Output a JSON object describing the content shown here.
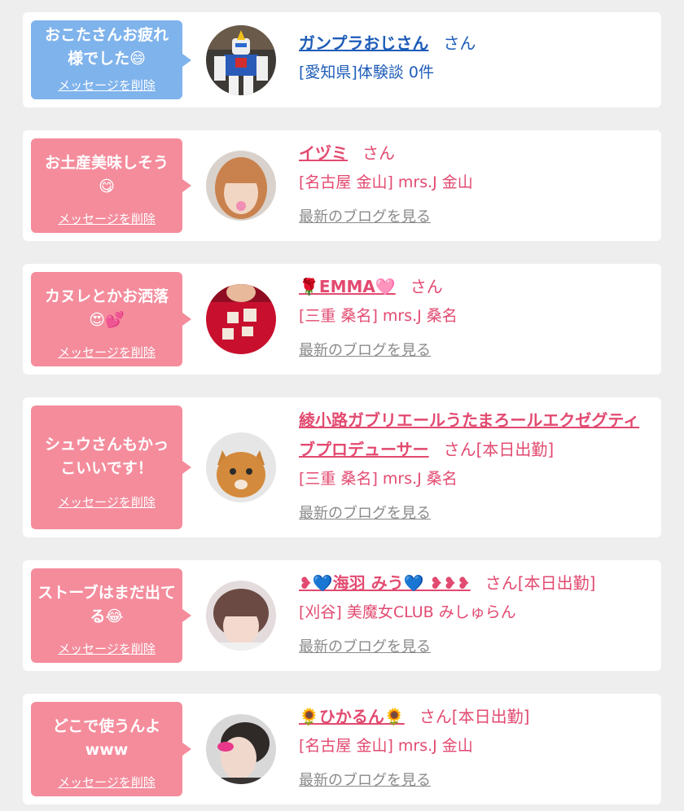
{
  "delete_label": "メッセージを削除",
  "blog_label": "最新のブログを見る",
  "colors": {
    "blue_bubble": "#7fb3ec",
    "pink_bubble": "#f48c9c",
    "blue_text": "#1d5cb8",
    "pink_text": "#e24a70",
    "gray_link": "#8a8a8a"
  },
  "entries": [
    {
      "message": "おこたさんお疲れ様でした😄",
      "name": "ガンプラおじさん",
      "honorific": "さん",
      "shop": "[愛知県]体験談 0件",
      "avatar_icon": "robot-figure-icon"
    },
    {
      "message": "お土産美味しそう😋",
      "name": "イヅミ",
      "honorific": "さん",
      "shop": "[名古屋 金山] mrs.J 金山",
      "avatar_icon": "woman-photo-icon"
    },
    {
      "message": "カヌレとかお洒落😍💕",
      "name": "🌹EMMA🩷",
      "honorific": "さん",
      "shop": "[三重 桑名] mrs.J 桑名",
      "avatar_icon": "red-shirt-photo-icon"
    },
    {
      "message": "シュウさんもかっこいいです！",
      "name": "綾小路ガブリエールうたまろールエクゼグティブプロデューサー",
      "honorific": "さん[本日出勤]",
      "shop": "[三重 桑名] mrs.J 桑名",
      "avatar_icon": "cat-photo-icon"
    },
    {
      "message": "ストーブはまだ出てる😂",
      "name": "❥💙海羽 みう💙 ❥❥❥",
      "honorific": "さん[本日出勤]",
      "shop": "[刈谷] 美魔女CLUB みしゅらん",
      "avatar_icon": "woman-photo-icon"
    },
    {
      "message": "どこで使うんよwww",
      "name": "🌻ひかるん🌻",
      "honorific": "さん[本日出勤]",
      "shop": "[名古屋 金山] mrs.J 金山",
      "avatar_icon": "woman-photo-icon"
    }
  ]
}
